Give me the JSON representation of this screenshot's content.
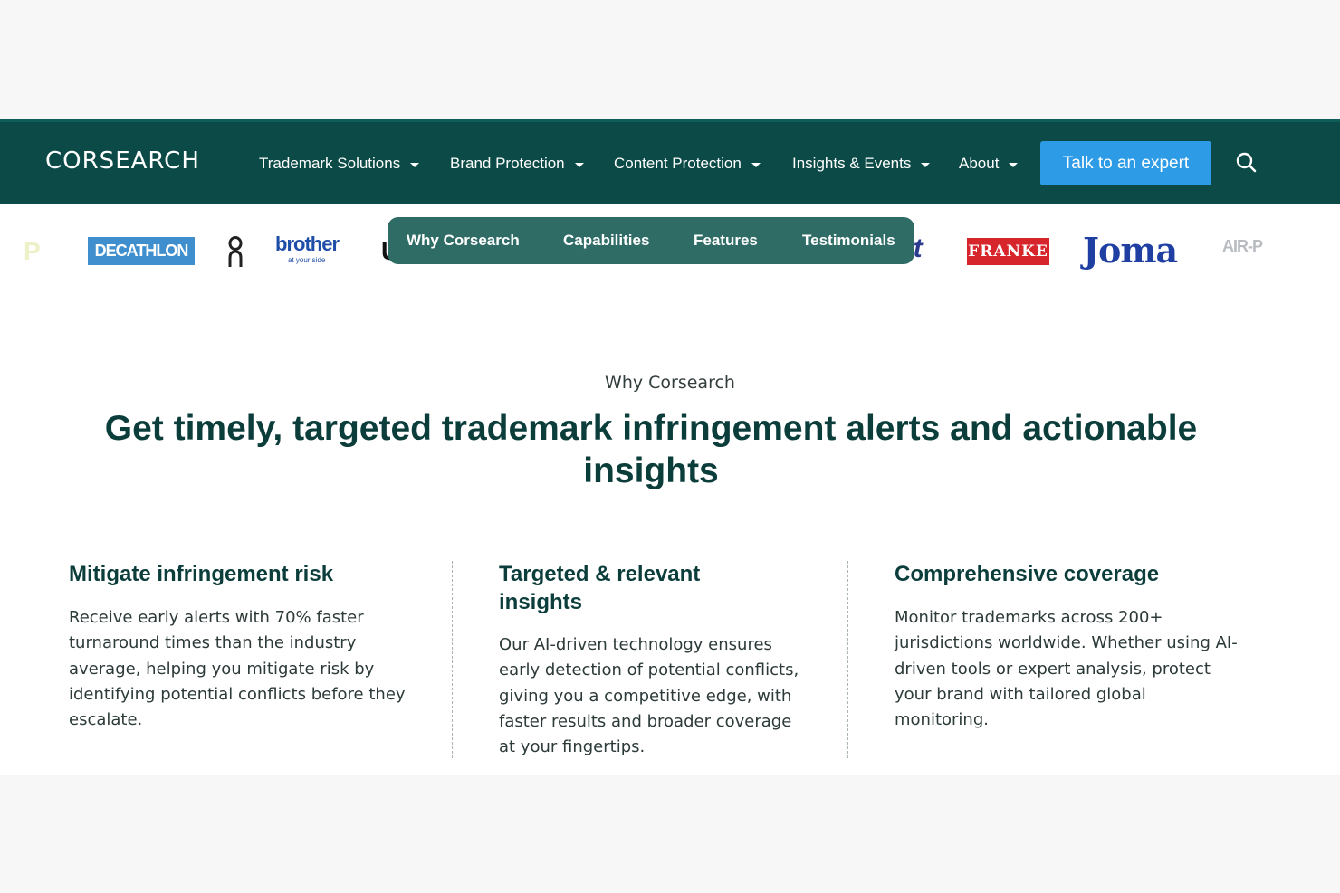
{
  "header": {
    "logo": "CORSEARCH",
    "nav": [
      {
        "label": "Trademark Solutions"
      },
      {
        "label": "Brand Protection"
      },
      {
        "label": "Content Protection"
      },
      {
        "label": "Insights & Events"
      },
      {
        "label": "About"
      }
    ],
    "cta_label": "Talk to an expert",
    "search_icon": "search-icon"
  },
  "logos": {
    "decathlon": "DECATHLON",
    "brother": "brother",
    "brother_tagline": "at your side",
    "franke": "FRANKE",
    "joma": "Joma",
    "air": "AIR-P",
    "partial_et": "et",
    "partial_p": "P",
    "partial_u": "U"
  },
  "subnav": {
    "tabs": [
      "Why Corsearch",
      "Capabilities",
      "Features",
      "Testimonials"
    ]
  },
  "hero": {
    "eyebrow": "Why Corsearch",
    "headline": "Get timely, targeted trademark infringement alerts and actionable insights"
  },
  "features": [
    {
      "title": "Mitigate infringement risk",
      "body": "Receive early alerts with 70% faster turnaround times than the industry average, helping you mitigate risk by identifying potential conflicts before they escalate."
    },
    {
      "title": "Targeted & relevant insights",
      "body": "Our AI-driven technology ensures early detection of potential conflicts, giving you a competitive edge, with faster results and broader coverage at your fingertips."
    },
    {
      "title": "Comprehensive coverage",
      "body": "Monitor trademarks across 200+ jurisdictions worldwide. Whether using AI-driven tools or expert analysis, protect your brand with tailored global monitoring."
    }
  ],
  "colors": {
    "nav_bg": "#0b4a46",
    "cta_bg": "#2e9be6",
    "subnav_bg": "#2f6c66",
    "text_primary": "#0b3d3b"
  }
}
